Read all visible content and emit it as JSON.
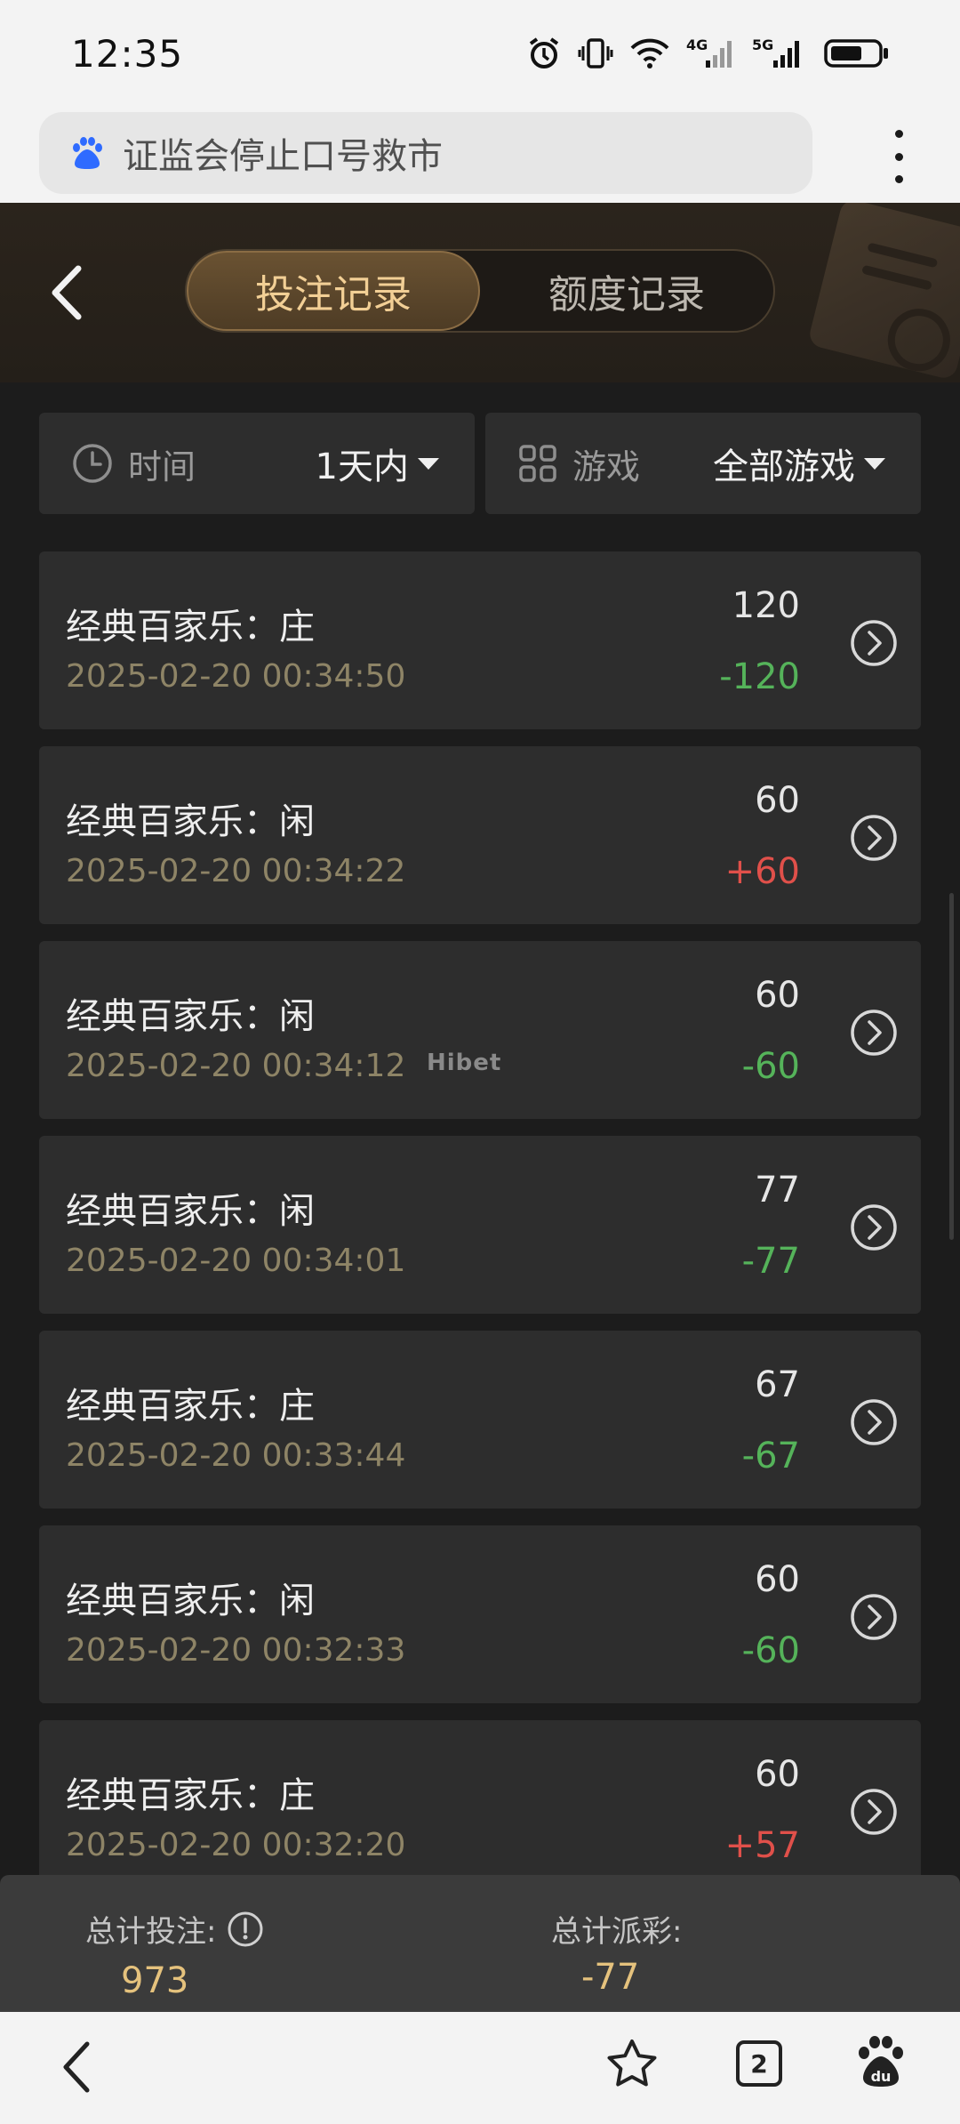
{
  "status_bar": {
    "time": "12:35",
    "icons": [
      "alarm-icon",
      "vibrate-icon",
      "wifi-icon",
      "signal-4g-icon",
      "signal-5g-icon",
      "battery-icon"
    ],
    "network_1": "4G",
    "network_2": "5G"
  },
  "browser": {
    "address_text": "证监会停止口号救市",
    "menu_icon": "more-vert-icon"
  },
  "header": {
    "tabs": [
      {
        "label": "投注记录",
        "active": true
      },
      {
        "label": "额度记录",
        "active": false
      }
    ]
  },
  "filters": {
    "time": {
      "label": "时间",
      "value": "1天内"
    },
    "game": {
      "label": "游戏",
      "value": "全部游戏"
    }
  },
  "records": [
    {
      "title": "经典百家乐：庄",
      "time": "2025-02-20 00:34:50",
      "bet": "120",
      "result": "-120"
    },
    {
      "title": "经典百家乐：闲",
      "time": "2025-02-20 00:34:22",
      "bet": "60",
      "result": "+60"
    },
    {
      "title": "经典百家乐：闲",
      "time": "2025-02-20 00:34:12",
      "bet": "60",
      "result": "-60"
    },
    {
      "title": "经典百家乐：闲",
      "time": "2025-02-20 00:34:01",
      "bet": "77",
      "result": "-77"
    },
    {
      "title": "经典百家乐：庄",
      "time": "2025-02-20 00:33:44",
      "bet": "67",
      "result": "-67"
    },
    {
      "title": "经典百家乐：闲",
      "time": "2025-02-20 00:32:33",
      "bet": "60",
      "result": "-60"
    },
    {
      "title": "经典百家乐：庄",
      "time": "2025-02-20 00:32:20",
      "bet": "60",
      "result": "+57"
    }
  ],
  "watermark": "Hibet",
  "summary": {
    "total_bet_label": "总计投注:",
    "total_bet_value": "973",
    "total_payout_label": "总计派彩:",
    "total_payout_value": "-77"
  },
  "bottom_nav": {
    "tab_count": "2"
  },
  "colors": {
    "negative": "#55b35a",
    "positive": "#e0504a",
    "gold": "#e5c27d",
    "timestamp": "#8e8466"
  }
}
